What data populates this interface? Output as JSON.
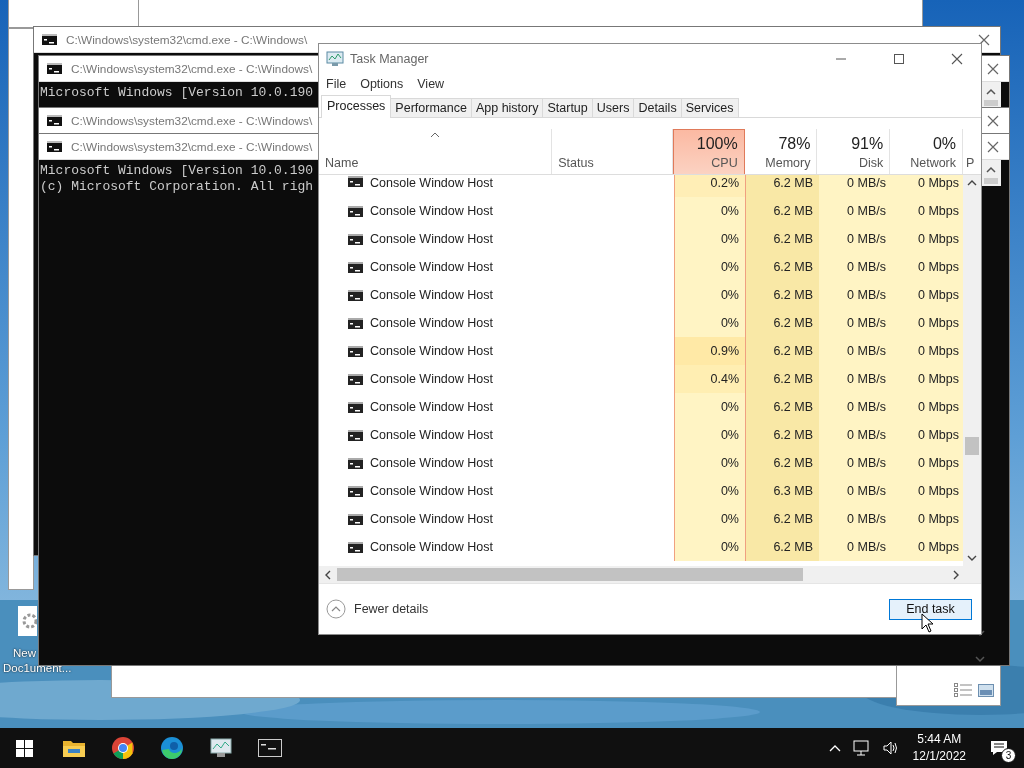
{
  "desktop_icon": {
    "label_lines": [
      "New",
      "Doc1ument..."
    ]
  },
  "cmd_windows": [
    {
      "title": "C:\\Windows\\system32\\cmd.exe - C:\\Windows\\"
    },
    {
      "title": "C:\\Windows\\system32\\cmd.exe - C:\\Windows\\",
      "lines": [
        "Microsoft Windows [Version 10.0.190"
      ]
    },
    {
      "title": "C:\\Windows\\system32\\cmd.exe - C:\\Windows\\"
    },
    {
      "title": "C:\\Windows\\system32\\cmd.exe - C:\\Windows\\",
      "lines": [
        "Microsoft Windows [Version 10.0.190",
        "(c) Microsoft Corporation. All righ"
      ]
    }
  ],
  "task_manager": {
    "title": "Task Manager",
    "menu": [
      "File",
      "Options",
      "View"
    ],
    "tabs": [
      {
        "label": "Processes",
        "selected": true
      },
      {
        "label": "Performance",
        "selected": false
      },
      {
        "label": "App history",
        "selected": false
      },
      {
        "label": "Startup",
        "selected": false
      },
      {
        "label": "Users",
        "selected": false
      },
      {
        "label": "Details",
        "selected": false
      },
      {
        "label": "Services",
        "selected": false
      }
    ],
    "columns": [
      {
        "label": "Name",
        "sorted": true,
        "highlight": false
      },
      {
        "label": "Status",
        "sorted": false,
        "highlight": false
      },
      {
        "label": "CPU",
        "percent": "100%",
        "sorted": false,
        "highlight": true
      },
      {
        "label": "Memory",
        "percent": "78%",
        "sorted": false,
        "highlight": false,
        "color": "#f9e8a6"
      },
      {
        "label": "Disk",
        "percent": "91%",
        "sorted": false,
        "highlight": false,
        "color": "#fff4c4"
      },
      {
        "label": "Network",
        "percent": "0%",
        "sorted": false,
        "highlight": false,
        "color": "#fff4c4"
      },
      {
        "label": "P",
        "sorted": false,
        "highlight": false
      }
    ],
    "rows": [
      {
        "name": "Console Window Host",
        "cpu": "0.2%",
        "color": "#ffeeb6",
        "memory": "6.2 MB",
        "disk": "0 MB/s",
        "network": "0 Mbps"
      },
      {
        "name": "Console Window Host",
        "cpu": "0%",
        "color": "#fff4c4",
        "memory": "6.2 MB",
        "disk": "0 MB/s",
        "network": "0 Mbps"
      },
      {
        "name": "Console Window Host",
        "cpu": "0%",
        "color": "#fff4c4",
        "memory": "6.2 MB",
        "disk": "0 MB/s",
        "network": "0 Mbps"
      },
      {
        "name": "Console Window Host",
        "cpu": "0%",
        "color": "#fff4c4",
        "memory": "6.2 MB",
        "disk": "0 MB/s",
        "network": "0 Mbps"
      },
      {
        "name": "Console Window Host",
        "cpu": "0%",
        "color": "#fff4c4",
        "memory": "6.2 MB",
        "disk": "0 MB/s",
        "network": "0 Mbps"
      },
      {
        "name": "Console Window Host",
        "cpu": "0%",
        "color": "#fff4c4",
        "memory": "6.2 MB",
        "disk": "0 MB/s",
        "network": "0 Mbps"
      },
      {
        "name": "Console Window Host",
        "cpu": "0.9%",
        "color": "#ffe9a6",
        "memory": "6.2 MB",
        "disk": "0 MB/s",
        "network": "0 Mbps"
      },
      {
        "name": "Console Window Host",
        "cpu": "0.4%",
        "color": "#ffeeb2",
        "memory": "6.2 MB",
        "disk": "0 MB/s",
        "network": "0 Mbps"
      },
      {
        "name": "Console Window Host",
        "cpu": "0%",
        "color": "#fff4c4",
        "memory": "6.2 MB",
        "disk": "0 MB/s",
        "network": "0 Mbps"
      },
      {
        "name": "Console Window Host",
        "cpu": "0%",
        "color": "#fff4c4",
        "memory": "6.2 MB",
        "disk": "0 MB/s",
        "network": "0 Mbps"
      },
      {
        "name": "Console Window Host",
        "cpu": "0%",
        "color": "#fff4c4",
        "memory": "6.2 MB",
        "disk": "0 MB/s",
        "network": "0 Mbps"
      },
      {
        "name": "Console Window Host",
        "cpu": "0%",
        "color": "#fff4c4",
        "memory": "6.3 MB",
        "disk": "0 MB/s",
        "network": "0 Mbps"
      },
      {
        "name": "Console Window Host",
        "cpu": "0%",
        "color": "#fff4c4",
        "memory": "6.2 MB",
        "disk": "0 MB/s",
        "network": "0 Mbps"
      },
      {
        "name": "Console Window Host",
        "cpu": "0%",
        "color": "#fff4c4",
        "memory": "6.2 MB",
        "disk": "0 MB/s",
        "network": "0 Mbps"
      }
    ],
    "footer": {
      "toggle": "Fewer details",
      "button": "End task"
    }
  },
  "taskbar": {
    "apps": [
      {
        "kind": "start"
      },
      {
        "kind": "explorer"
      },
      {
        "kind": "chrome"
      },
      {
        "kind": "edge"
      },
      {
        "kind": "taskmgr"
      },
      {
        "kind": "cmd"
      }
    ],
    "time": "5:44 AM",
    "date": "12/1/2022",
    "notification_count": "3"
  }
}
